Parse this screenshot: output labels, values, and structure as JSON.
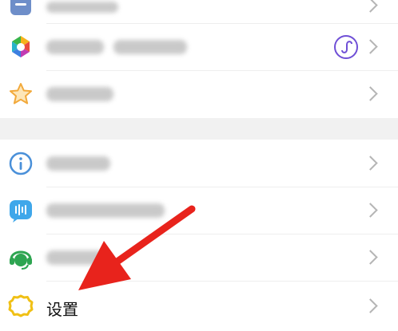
{
  "menu": {
    "settings_label": "设置"
  },
  "colors": {
    "arrow": "#e8231c",
    "settings_icon": "#f0c015",
    "info_icon": "#4a90d9",
    "chat_icon": "#3fa7ea",
    "service_icon": "#2ea551",
    "star_icon": "#f7b84b",
    "miniapp_icon": "#6f4fd6"
  },
  "icons": [
    "list-icon",
    "photo-album-icon",
    "star-icon",
    "info-icon",
    "chat-bubble-icon",
    "customer-service-icon",
    "gear-icon",
    "mini-program-icon"
  ]
}
